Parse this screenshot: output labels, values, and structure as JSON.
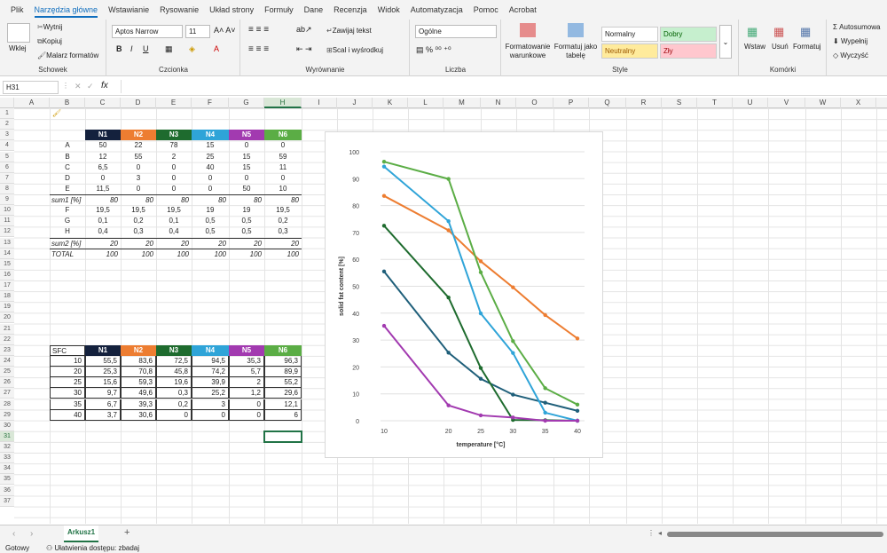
{
  "menu": [
    "Plik",
    "Narzędzia główne",
    "Wstawianie",
    "Rysowanie",
    "Układ strony",
    "Formuły",
    "Dane",
    "Recenzja",
    "Widok",
    "Automatyzacja",
    "Pomoc",
    "Acrobat"
  ],
  "ribbon": {
    "clipboard": {
      "paste": "Wklej",
      "cut": "Wytnij",
      "copy": "Kopiuj",
      "painter": "Malarz formatów",
      "label": "Schowek"
    },
    "font": {
      "name": "Aptos Narrow",
      "size": "11",
      "label": "Czcionka"
    },
    "align": {
      "wrap": "Zawijaj tekst",
      "merge": "Scal i wyśrodkuj",
      "label": "Wyrównanie"
    },
    "number": {
      "format": "Ogólne",
      "label": "Liczba"
    },
    "styles": {
      "cond": "Formatowanie warunkowe",
      "table": "Formatuj jako tabelę",
      "normal": "Normalny",
      "good": "Dobry",
      "neutral": "Neutralny",
      "bad": "Zły",
      "label": "Style"
    },
    "cells": {
      "insert": "Wstaw",
      "delete": "Usuń",
      "format": "Formatuj",
      "label": "Komórki"
    },
    "edit": {
      "autosum": "Autosumowa",
      "fill": "Wypełnij",
      "clear": "Wyczyść"
    }
  },
  "formula": {
    "namebox": "H31",
    "fx": "fx"
  },
  "columns": [
    "A",
    "B",
    "C",
    "D",
    "E",
    "F",
    "G",
    "H",
    "I",
    "J",
    "K",
    "L",
    "M",
    "N",
    "O",
    "P",
    "Q",
    "R",
    "S",
    "T",
    "U",
    "V",
    "W",
    "X"
  ],
  "table1": {
    "headers": [
      "N1",
      "N2",
      "N3",
      "N4",
      "N5",
      "N6"
    ],
    "header_colors": [
      "#14213d",
      "#ed7d31",
      "#1e6b2e",
      "#2fa4d8",
      "#a23ab0",
      "#5bad45"
    ],
    "rows": [
      [
        "A",
        "50",
        "22",
        "78",
        "15",
        "0",
        "0"
      ],
      [
        "B",
        "12",
        "55",
        "2",
        "25",
        "15",
        "59"
      ],
      [
        "C",
        "6,5",
        "0",
        "0",
        "40",
        "15",
        "11"
      ],
      [
        "D",
        "0",
        "3",
        "0",
        "0",
        "0",
        "0"
      ],
      [
        "E",
        "11,5",
        "0",
        "0",
        "0",
        "50",
        "10"
      ],
      [
        "sum1 [%]",
        "80",
        "80",
        "80",
        "80",
        "80",
        "80"
      ],
      [
        "F",
        "19,5",
        "19,5",
        "19,5",
        "19",
        "19",
        "19,5"
      ],
      [
        "G",
        "0,1",
        "0,2",
        "0,1",
        "0,5",
        "0,5",
        "0,2"
      ],
      [
        "H",
        "0,4",
        "0,3",
        "0,4",
        "0,5",
        "0,5",
        "0,3"
      ],
      [
        "sum2 [%]",
        "20",
        "20",
        "20",
        "20",
        "20",
        "20"
      ],
      [
        "TOTAL",
        "100",
        "100",
        "100",
        "100",
        "100",
        "100"
      ]
    ]
  },
  "table2": {
    "corner": "SFC",
    "headers": [
      "N1",
      "N2",
      "N3",
      "N4",
      "N5",
      "N6"
    ],
    "rows": [
      [
        "10",
        "55,5",
        "83,6",
        "72,5",
        "94,5",
        "35,3",
        "96,3"
      ],
      [
        "20",
        "25,3",
        "70,8",
        "45,8",
        "74,2",
        "5,7",
        "89,9"
      ],
      [
        "25",
        "15,6",
        "59,3",
        "19,6",
        "39,9",
        "2",
        "55,2"
      ],
      [
        "30",
        "9,7",
        "49,6",
        "0,3",
        "25,2",
        "1,2",
        "29,6"
      ],
      [
        "35",
        "6,7",
        "39,3",
        "0,2",
        "3",
        "0",
        "12,1"
      ],
      [
        "40",
        "3,7",
        "30,6",
        "0",
        "0",
        "0",
        "6"
      ]
    ]
  },
  "chart_data": {
    "type": "line",
    "x": [
      10,
      20,
      25,
      30,
      35,
      40
    ],
    "xlabel": "temperature [°C]",
    "ylabel": "solid fat content [%]",
    "ylim": [
      0,
      100
    ],
    "yticks": [
      0,
      10,
      20,
      30,
      40,
      50,
      60,
      70,
      80,
      90,
      100
    ],
    "series": [
      {
        "color": "#1f5f7a",
        "values": [
          55.5,
          25.3,
          15.6,
          9.7,
          6.7,
          3.7
        ]
      },
      {
        "color": "#ed7d31",
        "values": [
          83.6,
          70.8,
          59.3,
          49.6,
          39.3,
          30.6
        ]
      },
      {
        "color": "#1e6b2e",
        "values": [
          72.5,
          45.8,
          19.6,
          0.3,
          0.2,
          0
        ]
      },
      {
        "color": "#2fa4d8",
        "values": [
          94.5,
          74.2,
          39.9,
          25.2,
          3,
          0
        ]
      },
      {
        "color": "#a23ab0",
        "values": [
          35.3,
          5.7,
          2,
          1.2,
          0,
          0
        ]
      },
      {
        "color": "#5bad45",
        "values": [
          96.3,
          89.9,
          55.2,
          29.6,
          12.1,
          6
        ]
      }
    ]
  },
  "sheet": {
    "tab": "Arkusz1",
    "add": "+"
  },
  "status": {
    "ready": "Gotowy",
    "access": "Ułatwienia dostępu: zbadaj"
  }
}
